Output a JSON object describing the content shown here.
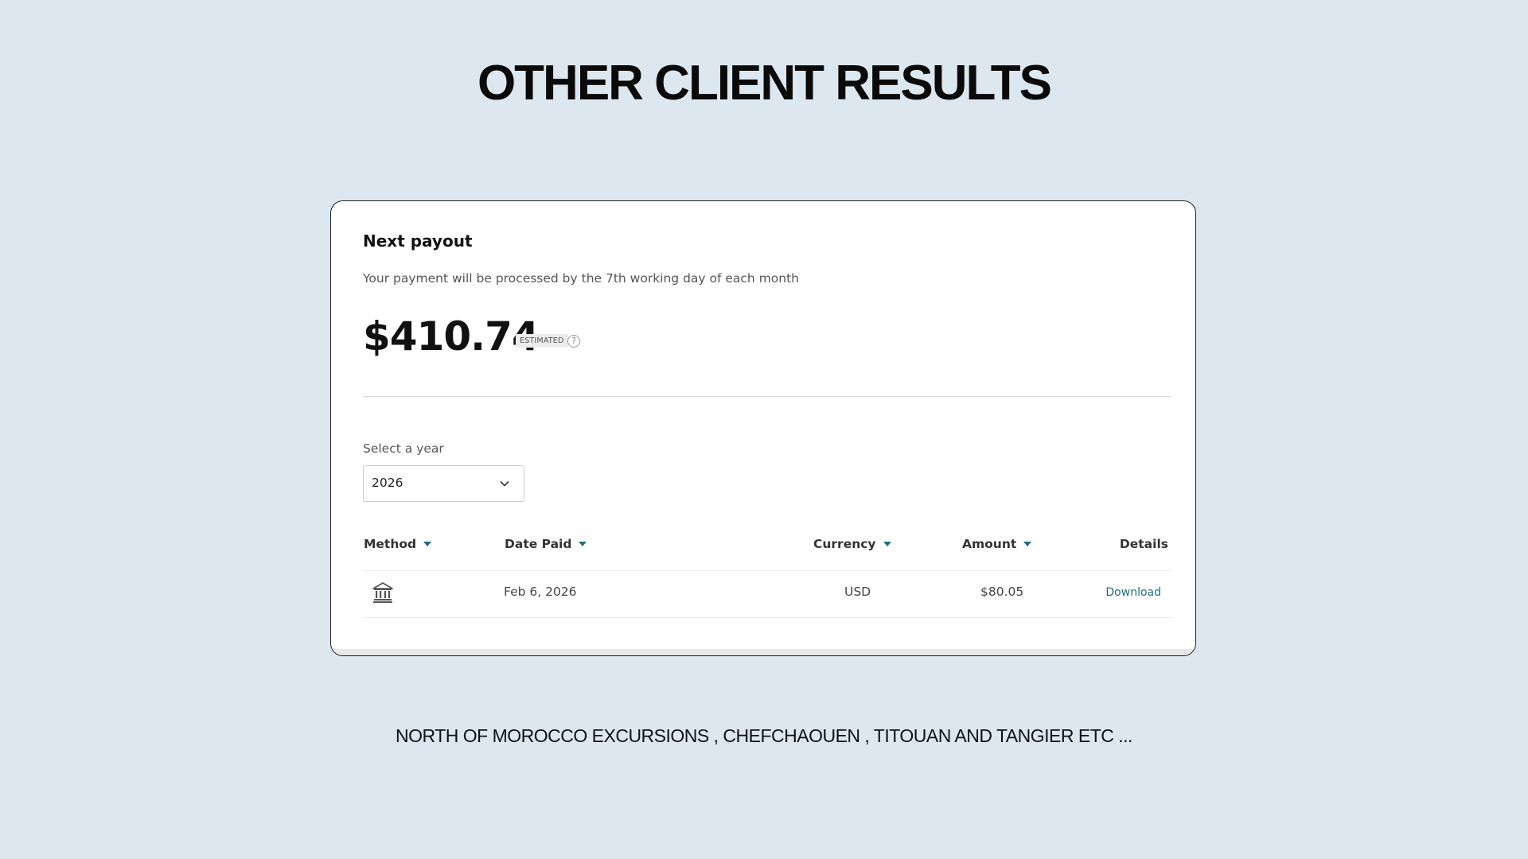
{
  "page": {
    "headline": "OTHER CLIENT RESULTS",
    "footer": "NORTH OF MOROCCO EXCURSIONS , CHEFCHAOUEN , TITOUAN AND TANGIER ETC ..."
  },
  "payout": {
    "title": "Next payout",
    "subtitle": "Your payment will be processed by the 7th working day of each month",
    "amount": "$410.74",
    "badge": "ESTIMATED",
    "help_icon": "question-circle-icon"
  },
  "year_select": {
    "label": "Select a year",
    "value": "2026",
    "icon": "chevron-down-icon"
  },
  "table": {
    "headers": {
      "method": "Method",
      "date_paid": "Date Paid",
      "currency": "Currency",
      "amount": "Amount",
      "details": "Details"
    },
    "rows": [
      {
        "method_icon": "bank-icon",
        "date_paid": "Feb 6, 2026",
        "currency": "USD",
        "amount": "$80.05",
        "details": "Download"
      }
    ]
  },
  "colors": {
    "background": "#dde7ef",
    "accent": "#1f6f78",
    "card": "#ffffff"
  }
}
